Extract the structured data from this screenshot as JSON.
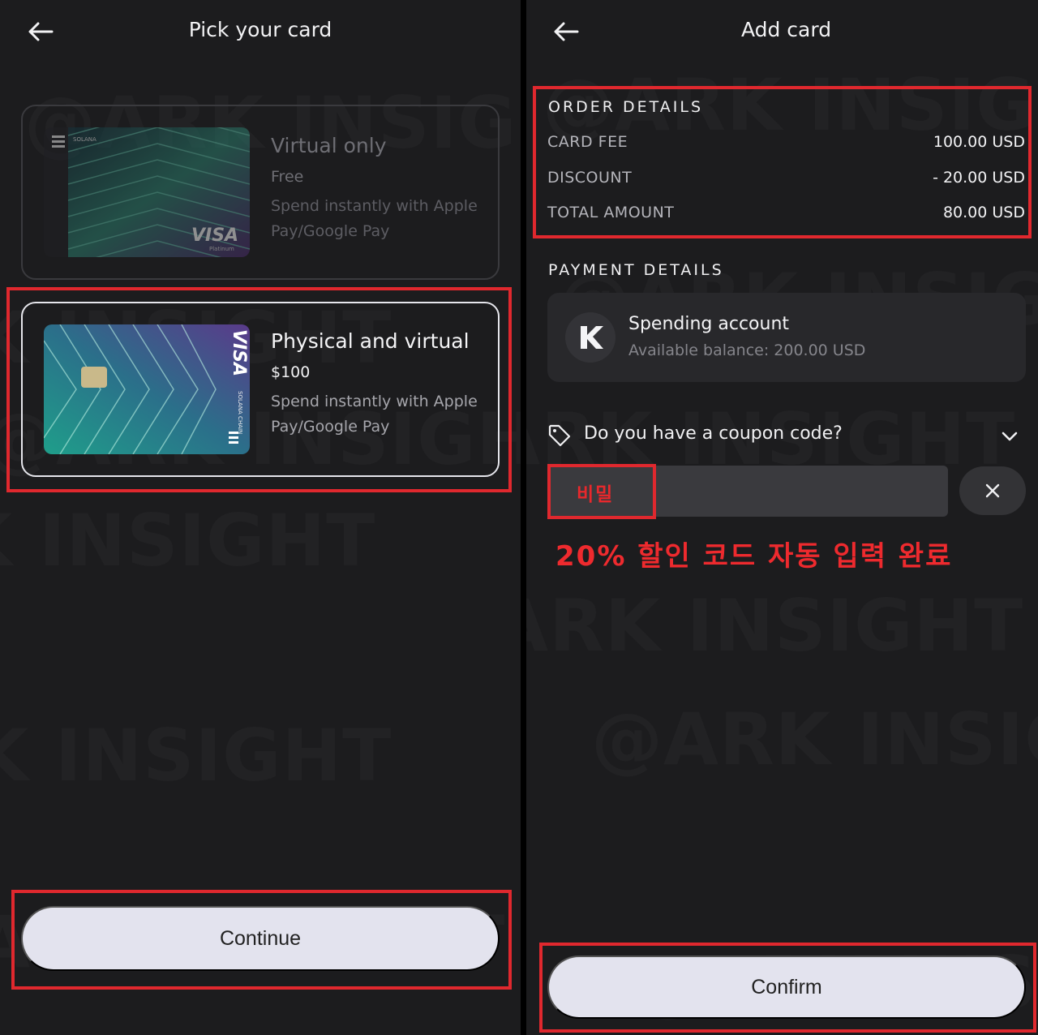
{
  "colors": {
    "background": "#1c1c1e",
    "highlight": "#e0282e",
    "button": "#e3e3ee",
    "annotation": "#ee2a2e"
  },
  "watermark_text": "@ARK INSIGHT",
  "left": {
    "title": "Pick your card",
    "back_icon": "arrow-left-icon",
    "options": [
      {
        "title": "Virtual only",
        "price": "Free",
        "desc": "Spend instantly with Apple Pay/Google Pay",
        "state": "unselected"
      },
      {
        "title": "Physical and virtual",
        "price": "$100",
        "desc": "Spend instantly with Apple Pay/Google Pay",
        "state": "selected"
      }
    ],
    "card_brand": "VISA",
    "card_tier": "Platinum",
    "card_network": "SOLANA CHAIN",
    "continue_label": "Continue"
  },
  "right": {
    "title": "Add card",
    "back_icon": "arrow-left-icon",
    "order": {
      "heading": "ORDER DETAILS",
      "rows": [
        {
          "label": "CARD FEE",
          "value": "100.00 USD"
        },
        {
          "label": "DISCOUNT",
          "value": "- 20.00 USD"
        },
        {
          "label": "TOTAL AMOUNT",
          "value": "80.00 USD"
        }
      ]
    },
    "payment": {
      "heading": "PAYMENT DETAILS",
      "account_name": "Spending account",
      "balance": "Available balance: 200.00 USD",
      "account_icon": "k-logo-icon"
    },
    "coupon": {
      "question": "Do you have a coupon code?",
      "tag_icon": "tag-icon",
      "chevron_icon": "chevron-down-icon",
      "value": "비밀",
      "clear_icon": "close-icon"
    },
    "annotation": "20% 할인 코드 자동 입력 완료",
    "confirm_label": "Confirm"
  }
}
